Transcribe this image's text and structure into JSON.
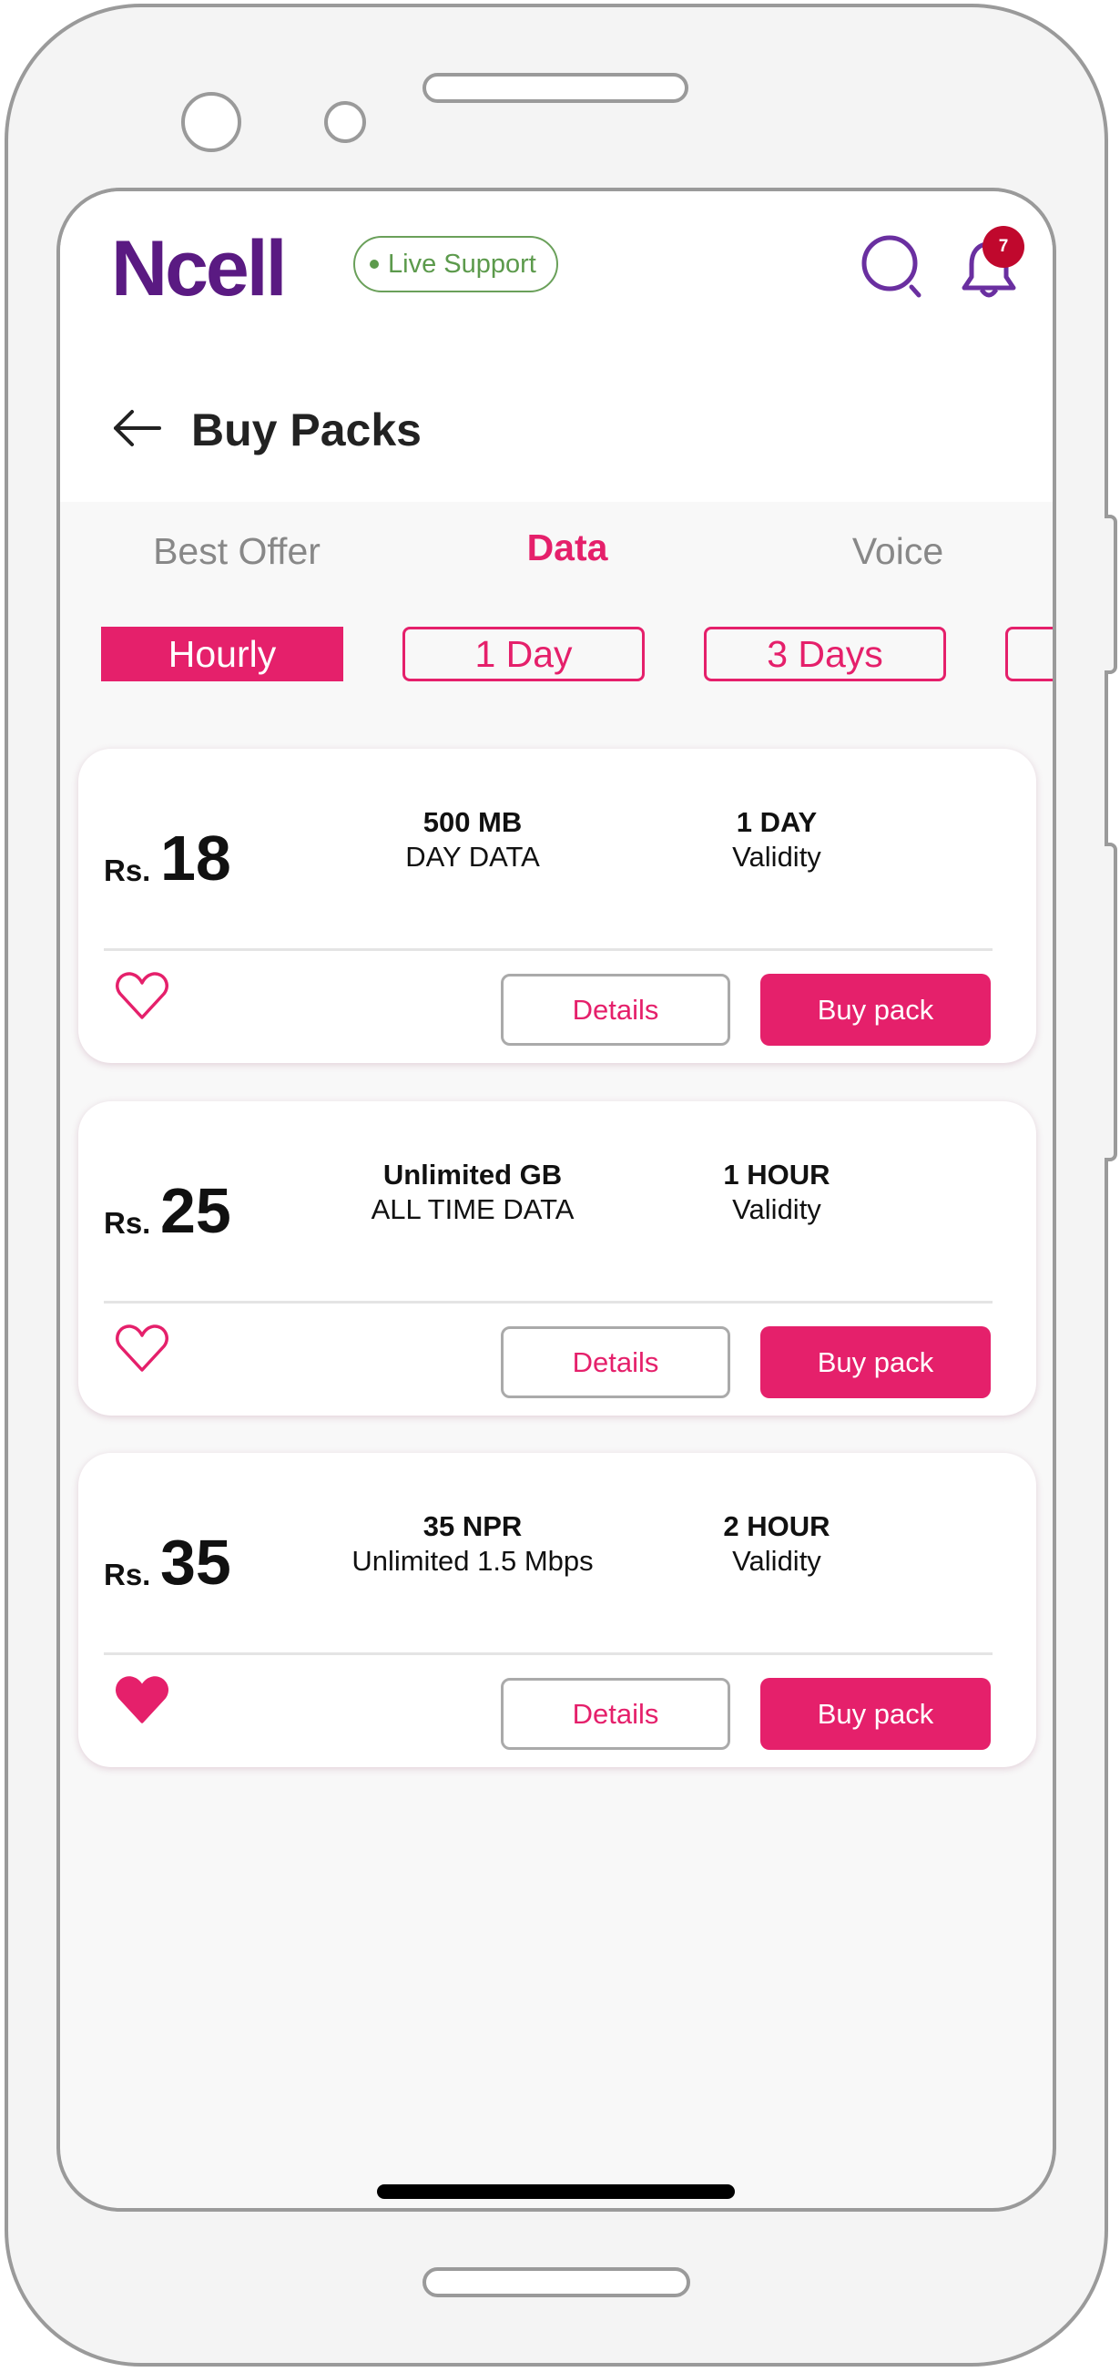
{
  "header": {
    "logo": "Ncell",
    "live_support": "Live Support",
    "notification_count": "7",
    "icons": {
      "search": "search-icon",
      "notifications": "bell-icon",
      "back": "arrow-left-icon"
    }
  },
  "page": {
    "title": "Buy Packs"
  },
  "tabs": [
    {
      "label": "Best Offer",
      "active": false
    },
    {
      "label": "Data",
      "active": true
    },
    {
      "label": "Voice",
      "active": false
    }
  ],
  "filters": [
    {
      "label": "Hourly",
      "active": true
    },
    {
      "label": "1 Day",
      "active": false
    },
    {
      "label": "3 Days",
      "active": false
    },
    {
      "label": "",
      "active": false
    }
  ],
  "colors": {
    "accent": "#e5206b",
    "brand": "#5a1a82",
    "live": "#5c9a4c",
    "badge": "#c0082d"
  },
  "packs": [
    {
      "currency": "Rs.",
      "price": "18",
      "volume": "500 MB",
      "volume_desc": "DAY DATA",
      "validity": "1 DAY",
      "validity_label": "Validity",
      "favorite": false,
      "details_label": "Details",
      "buy_label": "Buy pack"
    },
    {
      "currency": "Rs.",
      "price": "25",
      "volume": "Unlimited GB",
      "volume_desc": "ALL TIME DATA",
      "validity": "1 HOUR",
      "validity_label": "Validity",
      "favorite": false,
      "details_label": "Details",
      "buy_label": "Buy pack"
    },
    {
      "currency": "Rs.",
      "price": "35",
      "volume": "35 NPR",
      "volume_desc": "Unlimited 1.5 Mbps",
      "validity": "2 HOUR",
      "validity_label": "Validity",
      "favorite": true,
      "details_label": "Details",
      "buy_label": "Buy pack"
    }
  ]
}
